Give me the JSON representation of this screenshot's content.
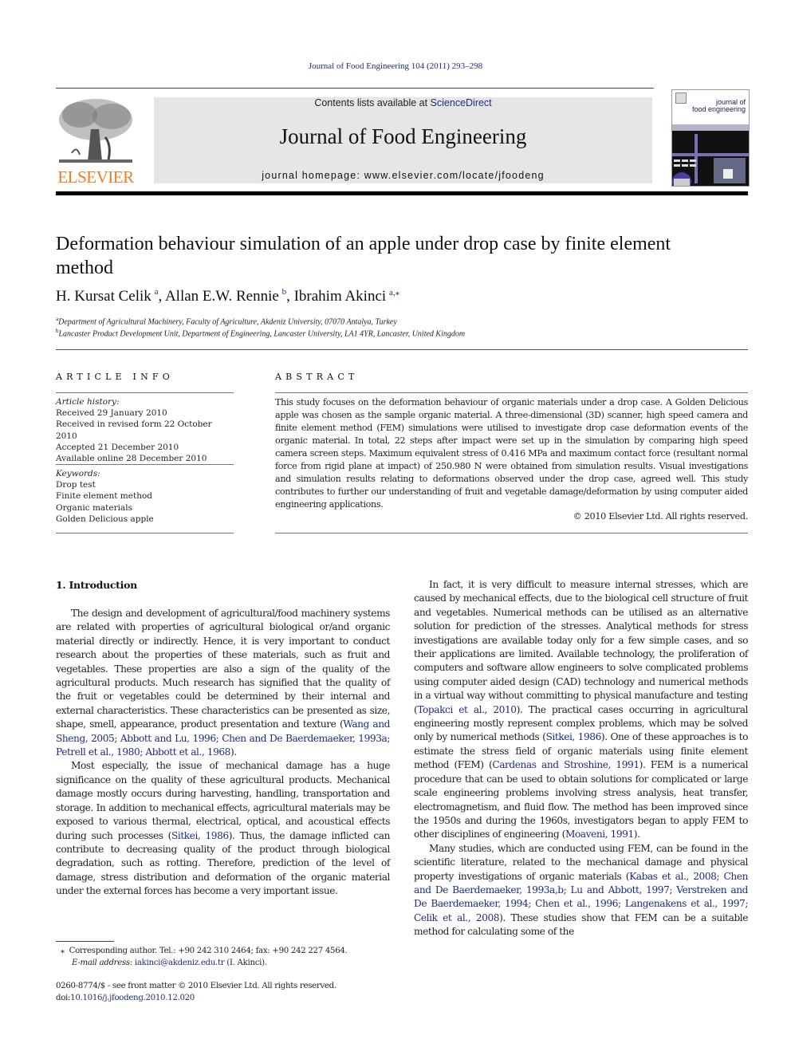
{
  "header": {
    "running_head": "Journal of Food Engineering 104 (2011) 293–298",
    "publisher_logo": "elsevier-tree-logo",
    "publisher_name": "ELSEVIER",
    "contents_prefix": "Contents lists available at ",
    "contents_link": "ScienceDirect",
    "journal_title": "Journal of Food Engineering",
    "homepage": "journal homepage: www.elsevier.com/locate/jfoodeng",
    "cover_title_line1": "journal of",
    "cover_title_line2": "food engineering"
  },
  "article": {
    "title": "Deformation behaviour simulation of an apple under drop case by finite element method",
    "authors": [
      {
        "name": "H. Kursat Celik",
        "sup": "a"
      },
      {
        "name": "Allan E.W. Rennie",
        "sup": "b"
      },
      {
        "name": "Ibrahim Akinci",
        "sup": "a,⁎"
      }
    ],
    "affiliations": [
      {
        "mark": "a",
        "text": "Department of Agricultural Machinery, Faculty of Agriculture, Akdeniz University, 07070 Antalya, Turkey"
      },
      {
        "mark": "b",
        "text": "Lancaster Product Development Unit, Department of Engineering, Lancaster University, LA1 4YR, Lancaster, United Kingdom"
      }
    ]
  },
  "article_info": {
    "label": "ARTICLE INFO",
    "history_label": "Article history:",
    "history": [
      "Received 29 January 2010",
      "Received in revised form 22 October 2010",
      "Accepted 21 December 2010",
      "Available online 28 December 2010"
    ],
    "keywords_label": "Keywords:",
    "keywords": [
      "Drop test",
      "Finite element method",
      "Organic materials",
      "Golden Delicious apple"
    ]
  },
  "abstract": {
    "label": "ABSTRACT",
    "text": "This study focuses on the deformation behaviour of organic materials under a drop case. A Golden Delicious apple was chosen as the sample organic material. A three-dimensional (3D) scanner, high speed camera and finite element method (FEM) simulations were utilised to investigate drop case deformation events of the organic material. In total, 22 steps after impact were set up in the simulation by comparing high speed camera screen steps. Maximum equivalent stress of 0.416 MPa and maximum contact force (resultant normal force from rigid plane at impact) of 250.980 N were obtained from simulation results. Visual investigations and simulation results relating to deformations observed under the drop case, agreed well. This study contributes to further our understanding of fruit and vegetable damage/deformation by using computer aided engineering applications.",
    "copyright": "© 2010 Elsevier Ltd. All rights reserved."
  },
  "body": {
    "section_heading": "1. Introduction",
    "p1_text": "The design and development of agricultural/food machinery systems are related with properties of agricultural biological or/and organic material directly or indirectly. Hence, it is very important to conduct research about the properties of these materials, such as fruit and vegetables. These properties are also a sign of the quality of the agricultural products. Much research has signified that the quality of the fruit or vegetables could be determined by their internal and external characteristics. These characteristics can be presented as size, shape, smell, appearance, product presentation and texture (",
    "p1_cite": "Wang and Sheng, 2005; Abbott and Lu, 1996; Chen and De Baerdemaeker, 1993a; Petrell et al., 1980; Abbott et al., 1968",
    "p1_end": ").",
    "p2_text": "Most especially, the issue of mechanical damage has a huge significance on the quality of these agricultural products. Mechanical damage mostly occurs during harvesting, handling, transportation and storage. In addition to mechanical effects, agricultural materials may be exposed to various thermal, electrical, optical, and acoustical effects during such processes (",
    "p2_cite": "Sitkei, 1986",
    "p2_end": "). Thus, the damage inflicted can contribute to decreasing quality of the product through biological degradation, such as rotting. Therefore, prediction of the level of damage, stress distribution and deformation of the organic material under the external forces has become a very important issue.",
    "p3_text": "In fact, it is very difficult to measure internal stresses, which are caused by mechanical effects, due to the biological cell structure of fruit and vegetables. Numerical methods can be utilised as an alternative solution for prediction of the stresses. Analytical methods for stress investigations are available today only for a few simple cases, and so their applications are limited. Available technology, the proliferation of computers and software allow engineers to solve complicated problems using computer aided design (CAD) technology and numerical methods in a virtual way without committing to physical manufacture and testing (",
    "p3_cite1": "Topakci et al., 2010",
    "p3_mid1": "). The practical cases occurring in agricultural engineering mostly represent complex problems, which may be solved only by numerical methods (",
    "p3_cite2": "Sitkei, 1986",
    "p3_mid2": "). One of these approaches is to estimate the stress field of organic materials using finite element method (FEM) (",
    "p3_cite3": "Cardenas and Stroshine, 1991",
    "p3_mid3": "). FEM is a numerical procedure that can be used to obtain solutions for complicated or large scale engineering problems involving stress analysis, heat transfer, electromagnetism, and fluid flow. The method has been improved since the 1950s and during the 1960s, investigators began to apply FEM to other disciplines of engineering (",
    "p3_cite4": "Moaveni, 1991",
    "p3_end": ").",
    "p4_text": "Many studies, which are conducted using FEM, can be found in the scientific literature, related to the mechanical damage and physical property investigations of organic materials (",
    "p4_cite": "Kabas et al., 2008; Chen and De Baerdemaeker, 1993a,b; Lu and Abbott, 1997; Verstreken and De Baerdemaeker, 1994; Chen et al., 1996; Langenakens et al., 1997; Celik et al., 2008",
    "p4_end": "). These studies show that FEM can be a suitable method for calculating some of the"
  },
  "footnotes": {
    "corresponding_mark": "⁎",
    "corresponding": "Corresponding author. Tel.: +90 242 310 2464; fax: +90 242 227 4564.",
    "email_label": "E-mail address:",
    "email": "iakinci@akdeniz.edu.tr",
    "email_suffix": " (I. Akinci).",
    "front_matter": "0260-8774/$ - see front matter © 2010 Elsevier Ltd. All rights reserved.",
    "doi_prefix": "doi:",
    "doi": "10.1016/j.jfoodeng.2010.12.020"
  }
}
